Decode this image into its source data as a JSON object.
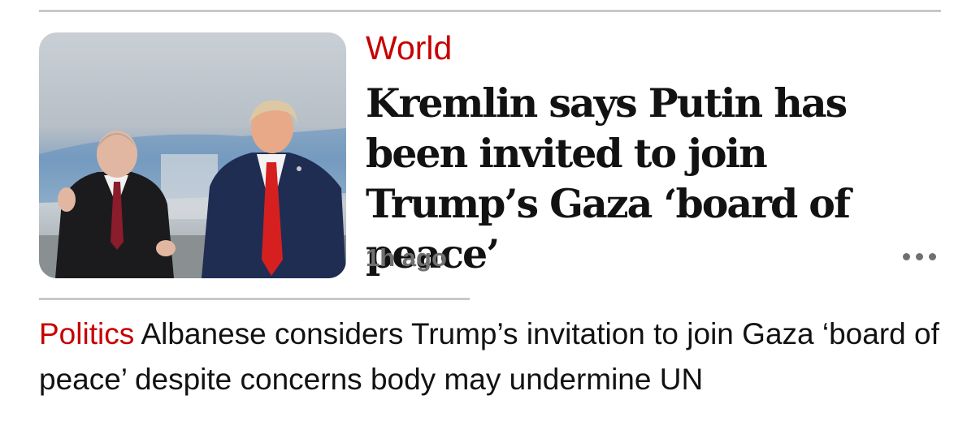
{
  "main_story": {
    "kicker": "World",
    "headline": "Kremlin says Putin has been invited to join Trump’s Gaza ‘board of peace’",
    "timestamp": "1h ago",
    "image_alt": "Vladimir Putin and Donald Trump in front of a plane"
  },
  "sublink": {
    "kicker": "Politics",
    "headline": "Albanese considers Trump’s invitation to join Gaza ‘board of peace’ despite concerns body may undermine UN"
  },
  "colors": {
    "accent": "#c70000",
    "headline": "#121212",
    "meta": "#707070",
    "rule": "#c8c8c8"
  }
}
